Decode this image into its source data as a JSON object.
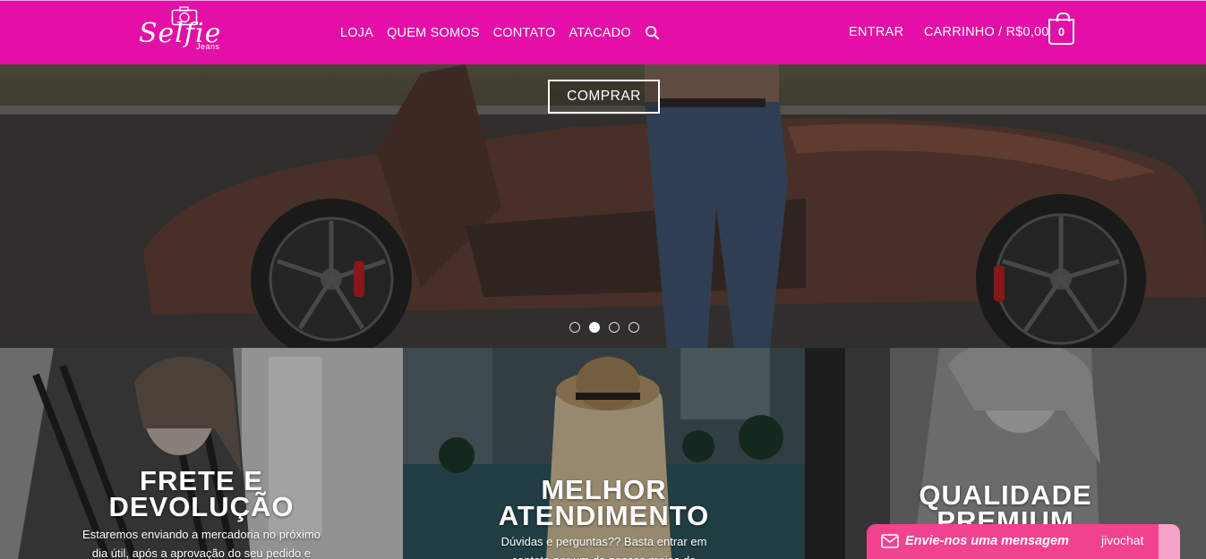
{
  "header": {
    "logo_text": "Selfie",
    "logo_sub": "Jeans",
    "nav": [
      "LOJA",
      "QUEM SOMOS",
      "CONTATO",
      "ATACADO"
    ],
    "login": "ENTRAR",
    "cart_label": "CARRINHO / R$0,00",
    "cart_count": "0",
    "accent_color": "#e30fa6"
  },
  "hero": {
    "button_label": "COMPRAR",
    "slides": 4,
    "active_slide": 2
  },
  "features": [
    {
      "title": "FRETE E\nDEVOLUÇÃO",
      "description": "Estaremos enviando a mercadoria no próximo dia útil, após a aprovação do seu pedido e"
    },
    {
      "title": "MELHOR\nATENDIMENTO",
      "description": "Dúvidas e perguntas?? Basta entrar em contato por um de nossos meios de"
    },
    {
      "title": "QUALIDADE\nPREMIUM",
      "description": ""
    }
  ],
  "chat": {
    "message": "Envie-nos uma mensagem",
    "brand": "jivochat",
    "color": "#f0428f"
  }
}
